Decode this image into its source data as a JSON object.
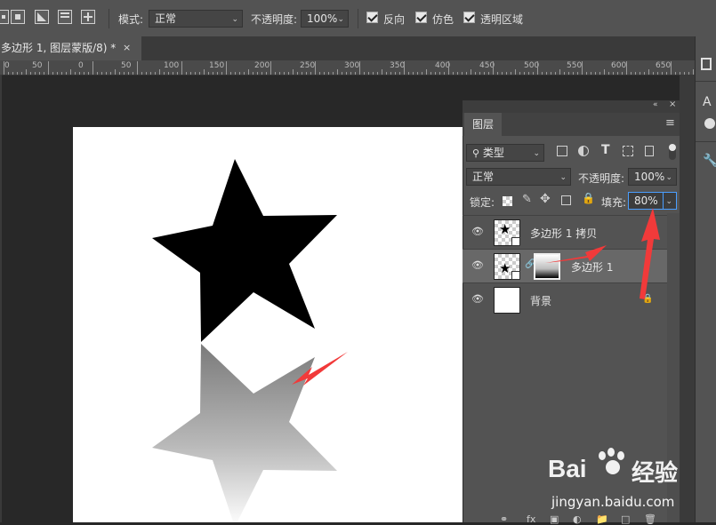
{
  "options_bar": {
    "mode_label": "模式:",
    "mode_value": "正常",
    "opacity_label": "不透明度:",
    "opacity_value": "100%",
    "reverse_label": "反向",
    "reverse_checked": true,
    "dither_label": "仿色",
    "dither_checked": true,
    "transparency_label": "透明区域",
    "transparency_checked": true
  },
  "document_tab": {
    "title": "多边形 1, 图层蒙版/8) *",
    "close_glyph": "×"
  },
  "ruler": {
    "labels": [
      "0",
      "50",
      "0",
      "50",
      "100",
      "150",
      "200",
      "250",
      "300",
      "350",
      "400",
      "450",
      "500",
      "550",
      "600",
      "650"
    ]
  },
  "layers_panel": {
    "tab_label": "图层",
    "filter_kind": "类型",
    "blend_mode": "正常",
    "opacity_label": "不透明度:",
    "opacity_value": "100%",
    "lock_label": "锁定:",
    "fill_label": "填充:",
    "fill_value": "80%",
    "layers": [
      {
        "name": "多边形 1 拷贝",
        "visible": true,
        "selected": false
      },
      {
        "name": "多边形 1",
        "visible": true,
        "selected": true,
        "has_mask": true
      },
      {
        "name": "背景",
        "visible": true,
        "selected": false,
        "locked": true
      }
    ]
  },
  "watermark": {
    "brand": "Bai",
    "brand_suffix": "经验",
    "url": "jingyan.baidu.com"
  },
  "colors": {
    "accent": "#4a9eff",
    "annotation_arrow": "#f13a3a",
    "panel_bg": "#535353",
    "workspace_bg": "#282828"
  }
}
